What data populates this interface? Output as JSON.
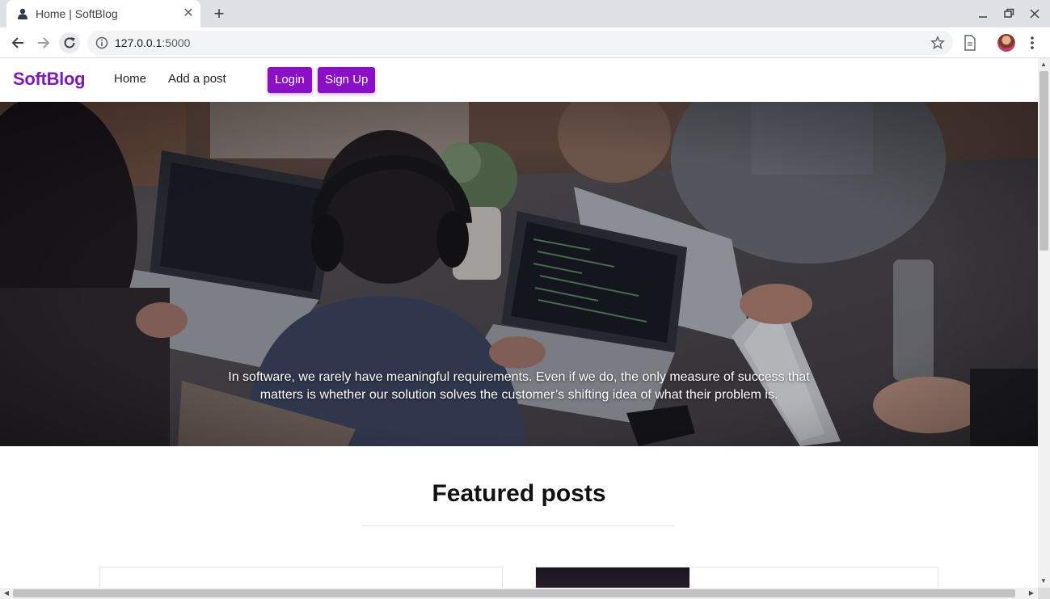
{
  "browser": {
    "tab_title": "Home | SoftBlog",
    "url_host": "127.0.0.1",
    "url_port": ":5000",
    "icons": {
      "favicon": "user-silhouette-icon",
      "close": "close-icon",
      "new_tab": "plus-icon",
      "back": "arrow-left-icon",
      "forward": "arrow-right-icon",
      "reload": "reload-icon",
      "info": "info-icon",
      "bookmark": "star-icon",
      "extension": "document-icon",
      "menu": "more-vert-icon"
    }
  },
  "site": {
    "brand": "SoftBlog",
    "nav": {
      "home": "Home",
      "add_post": "Add a post",
      "login": "Login",
      "signup": "Sign Up"
    },
    "hero": {
      "quote": "In software, we rarely have meaningful requirements. Even if we do, the only measure of success that matters is whether our solution solves the customer’s shifting idea of what their problem is."
    },
    "featured": {
      "title": "Featured posts"
    },
    "colors": {
      "brand": "#7e1bb3",
      "button": "#8a0fc7"
    }
  }
}
